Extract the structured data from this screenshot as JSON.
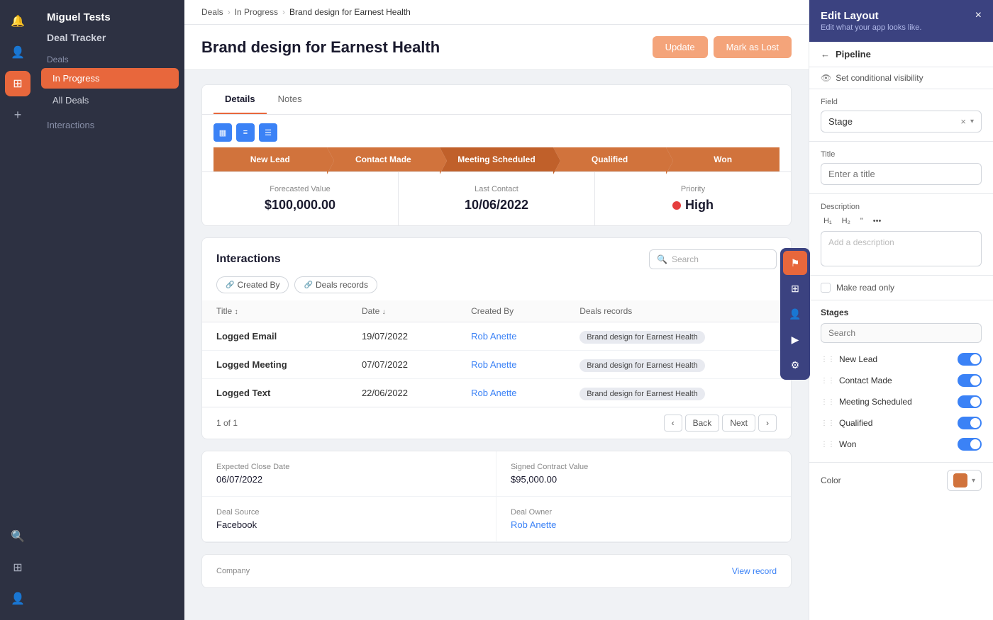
{
  "app": {
    "name": "Miguel Tests",
    "module": "Deal Tracker"
  },
  "sidebar": {
    "deals_label": "Deals",
    "in_progress_label": "In Progress",
    "all_deals_label": "All Deals",
    "interactions_label": "Interactions"
  },
  "breadcrumb": {
    "deals": "Deals",
    "in_progress": "In Progress",
    "current": "Brand design for Earnest Health"
  },
  "page": {
    "title": "Brand design for Earnest Health",
    "btn_update": "Update",
    "btn_mark_lost": "Mark as Lost"
  },
  "tabs": [
    {
      "label": "Details",
      "active": true
    },
    {
      "label": "Notes",
      "active": false
    }
  ],
  "pipeline": {
    "stages": [
      {
        "label": "New Lead",
        "active": false
      },
      {
        "label": "Contact Made",
        "active": false
      },
      {
        "label": "Meeting Scheduled",
        "active": true
      },
      {
        "label": "Qualified",
        "active": false
      },
      {
        "label": "Won",
        "active": false
      }
    ]
  },
  "stats": {
    "forecasted_value_label": "Forecasted Value",
    "forecasted_value": "$100,000.00",
    "last_contact_label": "Last Contact",
    "last_contact": "10/06/2022",
    "priority_label": "Priority",
    "priority_value": "High"
  },
  "interactions": {
    "title": "Interactions",
    "search_placeholder": "Search",
    "filter_tabs": [
      {
        "label": "Created By"
      },
      {
        "label": "Deals records"
      }
    ],
    "table": {
      "headers": [
        "Title",
        "Date",
        "Created By",
        "Deals records"
      ],
      "rows": [
        {
          "title": "Logged Email",
          "date": "19/07/2022",
          "created_by": "Rob Anette",
          "deals_record": "Brand design for Earnest Health"
        },
        {
          "title": "Logged Meeting",
          "date": "07/07/2022",
          "created_by": "Rob Anette",
          "deals_record": "Brand design for Earnest Health"
        },
        {
          "title": "Logged Text",
          "date": "22/06/2022",
          "created_by": "Rob Anette",
          "deals_record": "Brand design for Earnest Health"
        }
      ]
    },
    "pagination": {
      "summary": "1 of 1",
      "back_label": "Back",
      "next_label": "Next"
    }
  },
  "detail_fields": [
    {
      "label": "Expected Close Date",
      "value": "06/07/2022",
      "link": false
    },
    {
      "label": "Signed Contract Value",
      "value": "$95,000.00",
      "link": false
    },
    {
      "label": "Deal Source",
      "value": "Facebook",
      "link": false
    },
    {
      "label": "Deal Owner",
      "value": "Rob Anette",
      "link": true
    }
  ],
  "company": {
    "label": "Company",
    "view_record": "View record"
  },
  "edit_panel": {
    "title": "Edit Layout",
    "subtitle": "Edit what your app looks like.",
    "back_section": "Pipeline",
    "conditional_visibility": "Set conditional visibility",
    "field_label": "Field",
    "field_value": "Stage",
    "title_label": "Title",
    "title_placeholder": "Enter a title",
    "description_label": "Description",
    "desc_placeholder": "Add a description",
    "desc_tools": [
      "H1",
      "H2",
      "\"",
      "•••"
    ],
    "make_readonly_label": "Make read only",
    "stages_label": "Stages",
    "stages_search_placeholder": "Search",
    "stages": [
      {
        "label": "New Lead",
        "enabled": true
      },
      {
        "label": "Contact Made",
        "enabled": true
      },
      {
        "label": "Meeting Scheduled",
        "enabled": true
      },
      {
        "label": "Qualified",
        "enabled": true
      },
      {
        "label": "Won",
        "enabled": true
      }
    ],
    "color_label": "Color"
  },
  "icons": {
    "bell": "🔔",
    "grid": "⊞",
    "person": "👤",
    "plus": "+",
    "search": "🔍",
    "table_grid": "⊞",
    "user_group": "👥",
    "play": "▶",
    "settings": "⚙",
    "back_arrow": "←",
    "eye": "👁",
    "close": "×",
    "drag": "⋮⋮",
    "chevron_down": "▾",
    "sort_asc": "↑",
    "sort_desc": "↓",
    "link": "🔗",
    "search_sm": "🔍",
    "chevron_left": "‹",
    "chevron_right": "›"
  }
}
